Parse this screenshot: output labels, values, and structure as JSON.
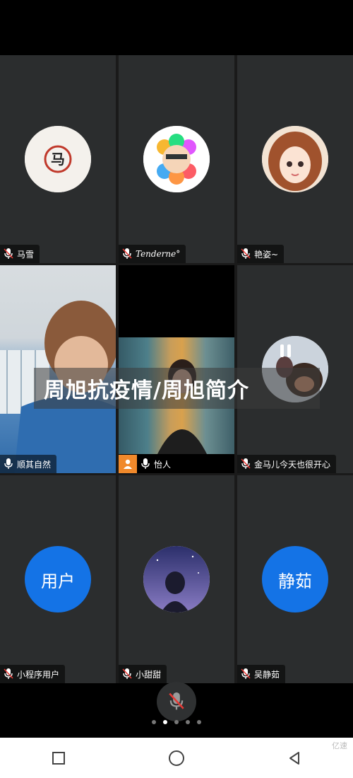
{
  "watermark_title": "周旭抗疫情/周旭简介",
  "participants": [
    {
      "name": "马雪",
      "avatar_text": "马"
    },
    {
      "name": "Tenderne°"
    },
    {
      "name": "艳姿~"
    },
    {
      "name": "顺其自然"
    },
    {
      "name": "怡人"
    },
    {
      "name": "金马儿今天也很开心"
    },
    {
      "name": "小程序用户",
      "avatar_text": "用户"
    },
    {
      "name": "小甜甜"
    },
    {
      "name": "吴静茹",
      "avatar_text": "静茹"
    }
  ],
  "page_indicator": {
    "count": 5,
    "active": 2
  },
  "corner_watermark": "亿速",
  "colors": {
    "accent_blue": "#1473e6",
    "mic_red": "#e53935",
    "person_orange": "#f0892b"
  }
}
